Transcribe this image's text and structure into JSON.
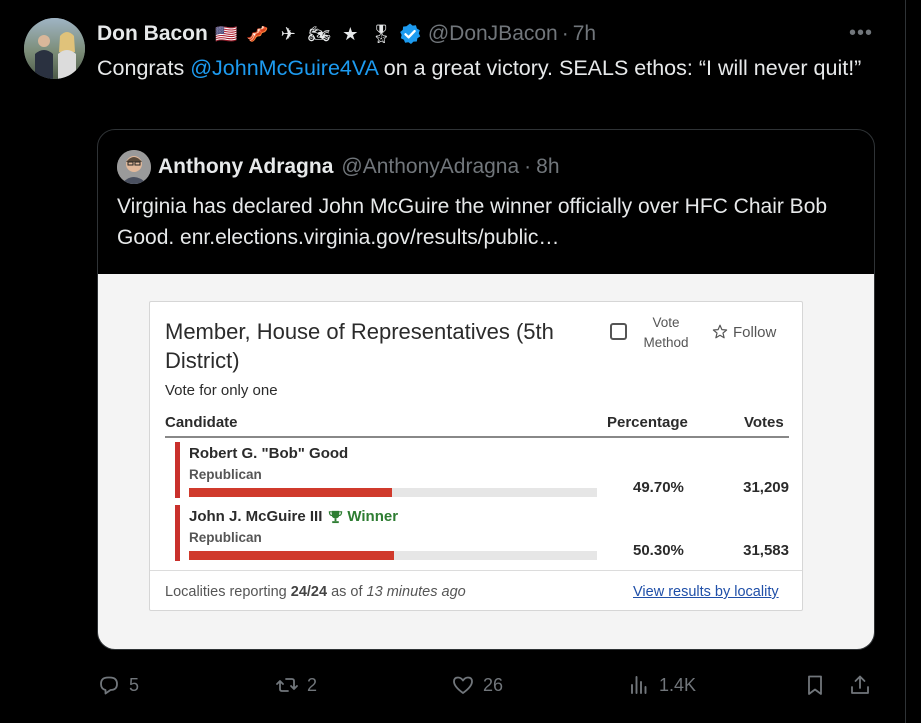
{
  "tweet": {
    "display_name": "Don Bacon",
    "emojis": [
      {
        "name": "us-flag-icon",
        "glyph": "🇺🇸"
      },
      {
        "name": "bacon-icon",
        "glyph": "🥓"
      },
      {
        "name": "airplane-icon",
        "glyph": "✈"
      },
      {
        "name": "motorcycle-icon",
        "glyph": "🏍"
      },
      {
        "name": "star-icon",
        "glyph": "★"
      },
      {
        "name": "medal-icon",
        "glyph": "🎖"
      }
    ],
    "handle": "@DonJBacon",
    "separator": "·",
    "time": "7h",
    "more": "•••",
    "text_before": "Congrats ",
    "mention": "@JohnMcGuire4VA",
    "text_after": " on a great victory. SEALS ethos: “I will never quit!”"
  },
  "quote": {
    "display_name": "Anthony Adragna",
    "handle": "@AnthonyAdragna",
    "separator": "·",
    "time": "8h",
    "text": "Virginia has declared John McGuire the winner officially over HFC Chair Bob Good. enr.elections.virginia.gov/results/public…"
  },
  "results_card": {
    "title": "Member, House of Representatives (5th District)",
    "vote_method_label": "Vote Method",
    "follow_label": "Follow",
    "vote_for": "Vote for only one",
    "col_candidate": "Candidate",
    "col_percentage": "Percentage",
    "col_votes": "Votes",
    "candidates": [
      {
        "name": "Robert G. \"Bob\" Good",
        "party": "Republican",
        "percentage": "49.70%",
        "votes": "31,209",
        "share": 0.497,
        "winner": false
      },
      {
        "name": "John J. McGuire III",
        "party": "Republican",
        "percentage": "50.30%",
        "votes": "31,583",
        "share": 0.503,
        "winner": true,
        "winner_label": "Winner"
      }
    ],
    "footer_prefix": "Localities reporting ",
    "footer_count": "24/24",
    "footer_mid": " as of ",
    "footer_time": "13 minutes ago",
    "footer_link": "View results by locality"
  },
  "actions": {
    "replies": "5",
    "reposts": "2",
    "likes": "26",
    "views": "1.4K"
  },
  "colors": {
    "accent": "#1d9bf0",
    "muted": "#71767b",
    "bar_red": "#d03a2c",
    "winner_green": "#2e7d32"
  }
}
